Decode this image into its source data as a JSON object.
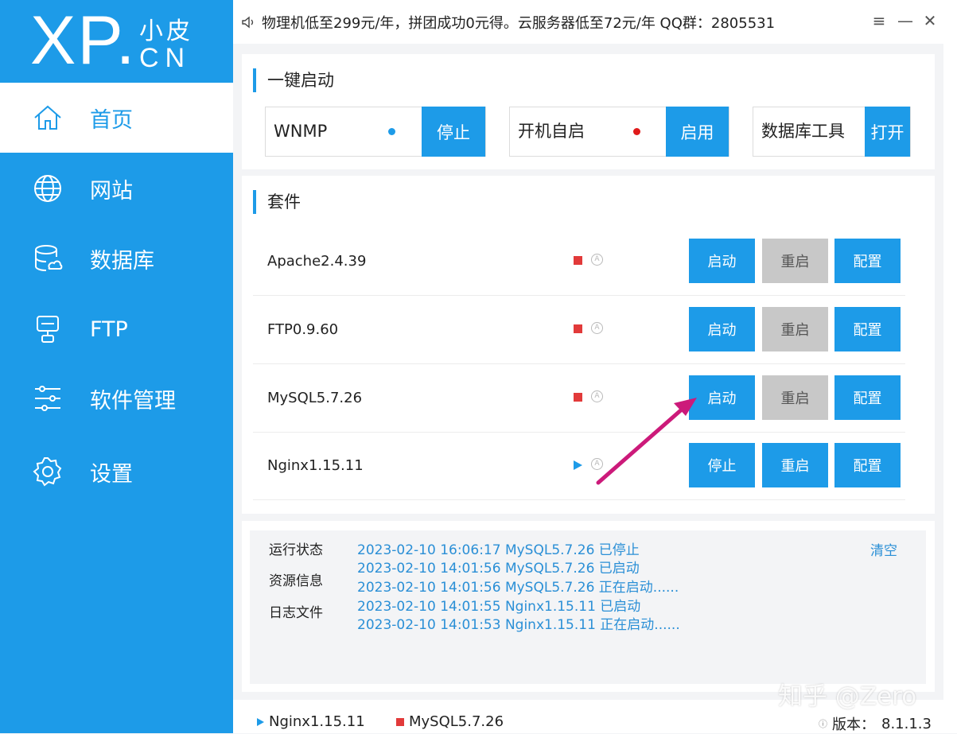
{
  "logo": {
    "main": "XP",
    "dot": ".",
    "small": "小皮",
    "cn": "CN"
  },
  "sidebar": {
    "items": [
      {
        "label": "首页",
        "icon": "home-icon"
      },
      {
        "label": "网站",
        "icon": "globe-icon"
      },
      {
        "label": "数据库",
        "icon": "database-icon"
      },
      {
        "label": "FTP",
        "icon": "server-icon"
      },
      {
        "label": "软件管理",
        "icon": "sliders-icon"
      },
      {
        "label": "设置",
        "icon": "gear-icon"
      }
    ]
  },
  "topbar": {
    "notice": "物理机低至299元/年，拼团成功0元得。云服务器低至72元/年 QQ群：2805531",
    "menu": "≡",
    "minimize": "—",
    "close": "✕"
  },
  "quick_start": {
    "title": "一键启动",
    "items": [
      {
        "label": "WNMP",
        "status_color": "#1d9be8",
        "button": "停止"
      },
      {
        "label": "开机自启",
        "status_color": "#e01a1a",
        "button": "启用"
      },
      {
        "label": "数据库工具",
        "button": "打开"
      }
    ]
  },
  "suite": {
    "title": "套件",
    "rows": [
      {
        "name": "Apache2.4.39",
        "state": "stopped",
        "auto": "A",
        "primary": "启动",
        "restart": "重启",
        "config": "配置"
      },
      {
        "name": "FTP0.9.60",
        "state": "stopped",
        "auto": "A",
        "primary": "启动",
        "restart": "重启",
        "config": "配置"
      },
      {
        "name": "MySQL5.7.26",
        "state": "stopped",
        "auto": "A",
        "primary": "启动",
        "restart": "重启",
        "config": "配置"
      },
      {
        "name": "Nginx1.15.11",
        "state": "running",
        "auto": "A",
        "primary": "停止",
        "restart": "重启",
        "config": "配置"
      }
    ]
  },
  "log": {
    "tabs": [
      "运行状态",
      "资源信息",
      "日志文件"
    ],
    "clear": "清空",
    "lines": [
      "2023-02-10 16:06:17 MySQL5.7.26 已停止",
      "2023-02-10 14:01:56 MySQL5.7.26 已启动",
      "2023-02-10 14:01:56 MySQL5.7.26 正在启动......",
      "2023-02-10 14:01:55 Nginx1.15.11 已启动",
      "2023-02-10 14:01:53 Nginx1.15.11 正在启动......"
    ]
  },
  "statusbar": {
    "nginx": "Nginx1.15.11",
    "mysql": "MySQL5.7.26",
    "version_label": "版本：",
    "version": "8.1.1.3"
  },
  "watermark": "知乎 @Zero",
  "colors": {
    "accent": "#1d9be8",
    "stopped": "#e23a3a",
    "disabled": "#c8c8c8",
    "annotation": "#cc1a7a"
  }
}
